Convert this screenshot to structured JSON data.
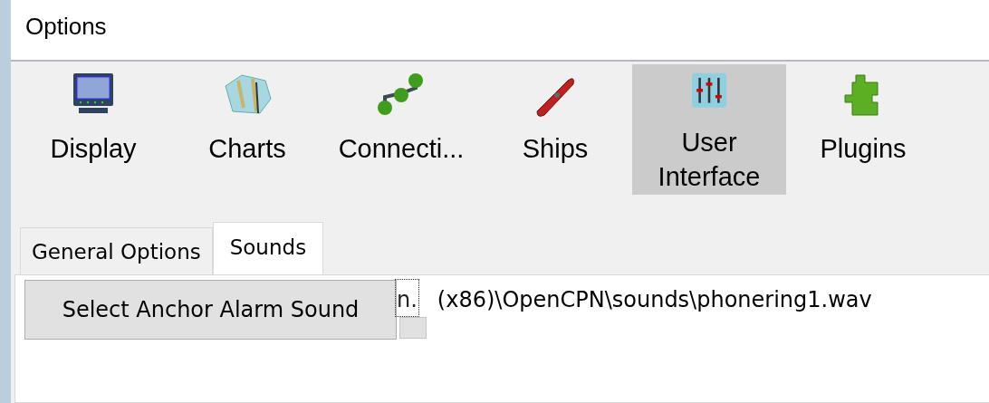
{
  "window": {
    "title": "Options"
  },
  "toolbar": [
    {
      "label": "Display",
      "kind": "display",
      "selected": false
    },
    {
      "label": "Charts",
      "kind": "charts",
      "selected": false
    },
    {
      "label": "Connecti...",
      "kind": "connections",
      "selected": false
    },
    {
      "label": "Ships",
      "kind": "ships",
      "selected": false
    },
    {
      "label": "User\nInterface",
      "kind": "ui",
      "selected": true
    },
    {
      "label": "Plugins",
      "kind": "plugins",
      "selected": false
    }
  ],
  "tabs": [
    {
      "label": "General Options",
      "selected": false
    },
    {
      "label": "Sounds",
      "selected": true
    }
  ],
  "sounds": {
    "button": "Select Anchor Alarm Sound",
    "path_fragment": "n.",
    "path": "(x86)\\OpenCPN\\sounds\\phonering1.wav"
  }
}
